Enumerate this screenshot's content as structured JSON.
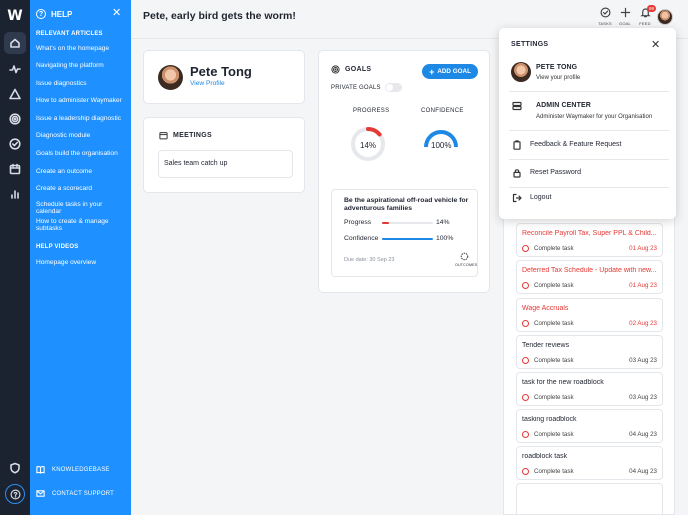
{
  "app": {
    "logo": "W"
  },
  "header": {
    "greeting": "Pete, early bird gets the worm!",
    "tasks_label": "TASKS",
    "goal_label": "GOAL",
    "feed_label": "FEED",
    "feed_badge": "69"
  },
  "rail": {
    "icons": [
      "home-icon",
      "activity-icon",
      "warning-icon",
      "target-icon",
      "check-circle-icon",
      "calendar-icon",
      "bar-chart-icon",
      "shield-icon",
      "help-icon"
    ]
  },
  "help": {
    "title": "HELP",
    "articles_heading": "RELEVANT ARTICLES",
    "articles": [
      "What's on the homepage",
      "Navigating the platform",
      "Issue diagnostics",
      "How to administer Waymaker",
      "Issue a leadership diagnostic",
      "Diagnostic module",
      "Goals build the organisation",
      "Create an outcome",
      "Create a scorecard",
      "Schedule tasks in your calendar",
      "How to create & manage subtasks"
    ],
    "videos_heading": "HELP VIDEOS",
    "videos": [
      "Homepage overview"
    ],
    "knowledgebase": "KNOWLEDGEBASE",
    "contact_support": "CONTACT SUPPORT"
  },
  "profile": {
    "name": "Pete Tong",
    "view_profile": "View Profile"
  },
  "meetings": {
    "title": "MEETINGS",
    "items": [
      "Sales team catch up"
    ]
  },
  "goals": {
    "title": "GOALS",
    "add_label": "ADD GOAL",
    "private_label": "PRIVATE GOALS",
    "private_on": false,
    "progress_label": "PROGRESS",
    "confidence_label": "CONFIDENCE",
    "progress_value": "14%",
    "confidence_value": "100%",
    "progress_fraction": 0.14,
    "confidence_fraction": 1.0,
    "item": {
      "title": "Be the aspirational off-road vehicle for adventurous families",
      "progress_label": "Progress",
      "progress_value": "14%",
      "confidence_label": "Confidence",
      "confidence_value": "100%",
      "due": "Due date: 30 Sep 23",
      "outcomes_label": "OUTCOMES"
    },
    "colors": {
      "progress": "#e53935",
      "confidence": "#1e88e5",
      "track": "#e6e8ec"
    }
  },
  "tasks": {
    "complete_label": "Complete task",
    "items": [
      {
        "title": "Reconcile Payroll Tax, Super PPL & Child...",
        "date": "01 Aug 23",
        "overdue": true
      },
      {
        "title": "Deferred Tax Schedule - Update with new...",
        "date": "01 Aug 23",
        "overdue": true
      },
      {
        "title": "Wage Accruals",
        "date": "02 Aug 23",
        "overdue": true
      },
      {
        "title": "Tender reviews",
        "date": "03 Aug 23",
        "overdue": false
      },
      {
        "title": "task for the new roadblock",
        "date": "03 Aug 23",
        "overdue": false
      },
      {
        "title": "tasking roadblock",
        "date": "04 Aug 23",
        "overdue": false
      },
      {
        "title": "roadblock task",
        "date": "04 Aug 23",
        "overdue": false
      }
    ]
  },
  "settings": {
    "title": "SETTINGS",
    "profile_name": "PETE TONG",
    "profile_sub": "View your profile",
    "admin_title": "ADMIN CENTER",
    "admin_sub": "Administer Waymaker for your Organisation",
    "feedback": "Feedback & Feature Request",
    "reset_password": "Reset Password",
    "logout": "Logout"
  }
}
